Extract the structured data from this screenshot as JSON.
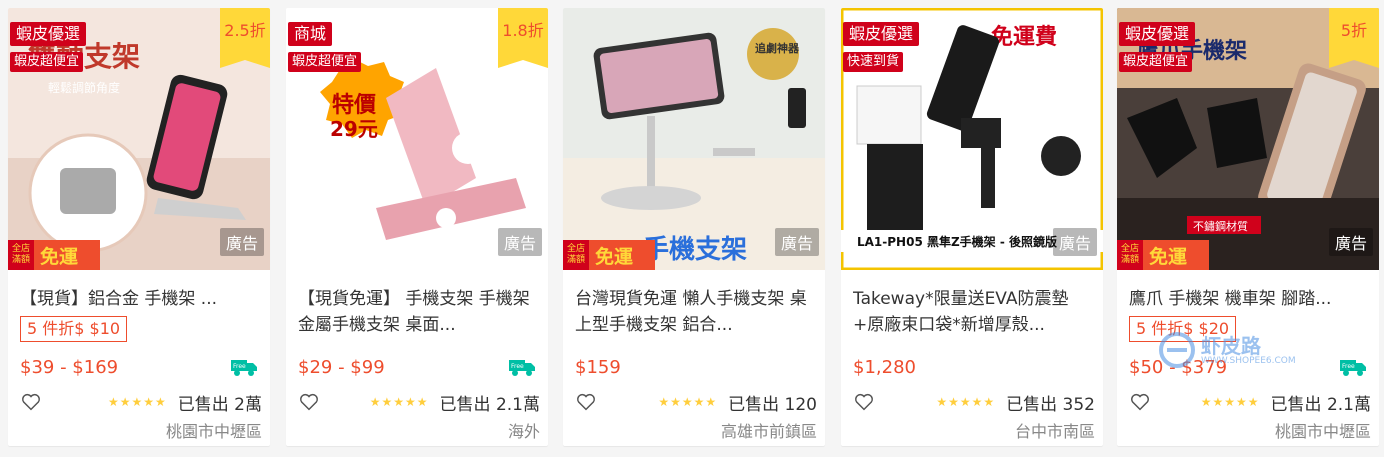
{
  "cards": [
    {
      "badge_primary": "蝦皮優選",
      "badge_secondary": "蝦皮超便宜",
      "discount": "2.5折",
      "ad_label": "廣告",
      "free_ship_small": "全店滿額",
      "free_ship_big": "免運",
      "title": "【現貨】鋁合金 手機架 ...",
      "promo": "5 件折$ $10",
      "price": "$39 - $169",
      "sold": "已售出 2萬",
      "location": "桃園市中壢區",
      "img_text_a": "雙軸支架",
      "img_text_b": "輕鬆調節角度"
    },
    {
      "badge_primary": "商城",
      "badge_secondary": "蝦皮超便宜",
      "discount": "1.8折",
      "ad_label": "廣告",
      "title": "【現貨免運】 手機支架 手機架 金屬手機支架 桌面...",
      "price": "$29 - $99",
      "sold": "已售出 2.1萬",
      "location": "海外",
      "img_text_a": "特價",
      "img_text_b": "29元"
    },
    {
      "ad_label": "廣告",
      "free_ship_small": "全店滿額",
      "free_ship_big": "免運",
      "title": "台灣現貨免運 懶人手機支架 桌上型手機支架 鋁合...",
      "price": "$159",
      "sold": "已售出 120",
      "location": "高雄市前鎮區",
      "img_text_a": "追劇神器",
      "img_text_b": "手機支架"
    },
    {
      "badge_primary": "蝦皮優選",
      "badge_secondary": "快速到貨",
      "ad_label": "廣告",
      "title": "Takeway*限量送EVA防震墊+原廠束口袋*新增厚殼...",
      "price": "$1,280",
      "sold": "已售出 352",
      "location": "台中市南區",
      "img_text_a": "免運費",
      "img_text_b": "LA1-PH05 黑隼Z手機架 - 後照鏡版"
    },
    {
      "badge_primary": "蝦皮優選",
      "badge_secondary": "蝦皮超便宜",
      "discount": "5折",
      "ad_label": "廣告",
      "free_ship_small": "全店滿額",
      "free_ship_big": "免運",
      "title": "鷹爪 手機架 機車架 腳踏...",
      "promo": "5 件折$ $20",
      "price": "$50 - $379",
      "sold": "已售出 2.1萬",
      "location": "桃園市中壢區",
      "img_text_a": "鷹爪手機架",
      "img_text_b": "不鏽鋼材質"
    }
  ],
  "watermark": {
    "brand": "虾皮路",
    "url": "WWW.SHOPEE6.COM"
  },
  "colors": {
    "brand": "#ee4d2d",
    "badge_red": "#d0011b",
    "discount_yellow": "#ffd839",
    "star": "#ffce3d"
  }
}
